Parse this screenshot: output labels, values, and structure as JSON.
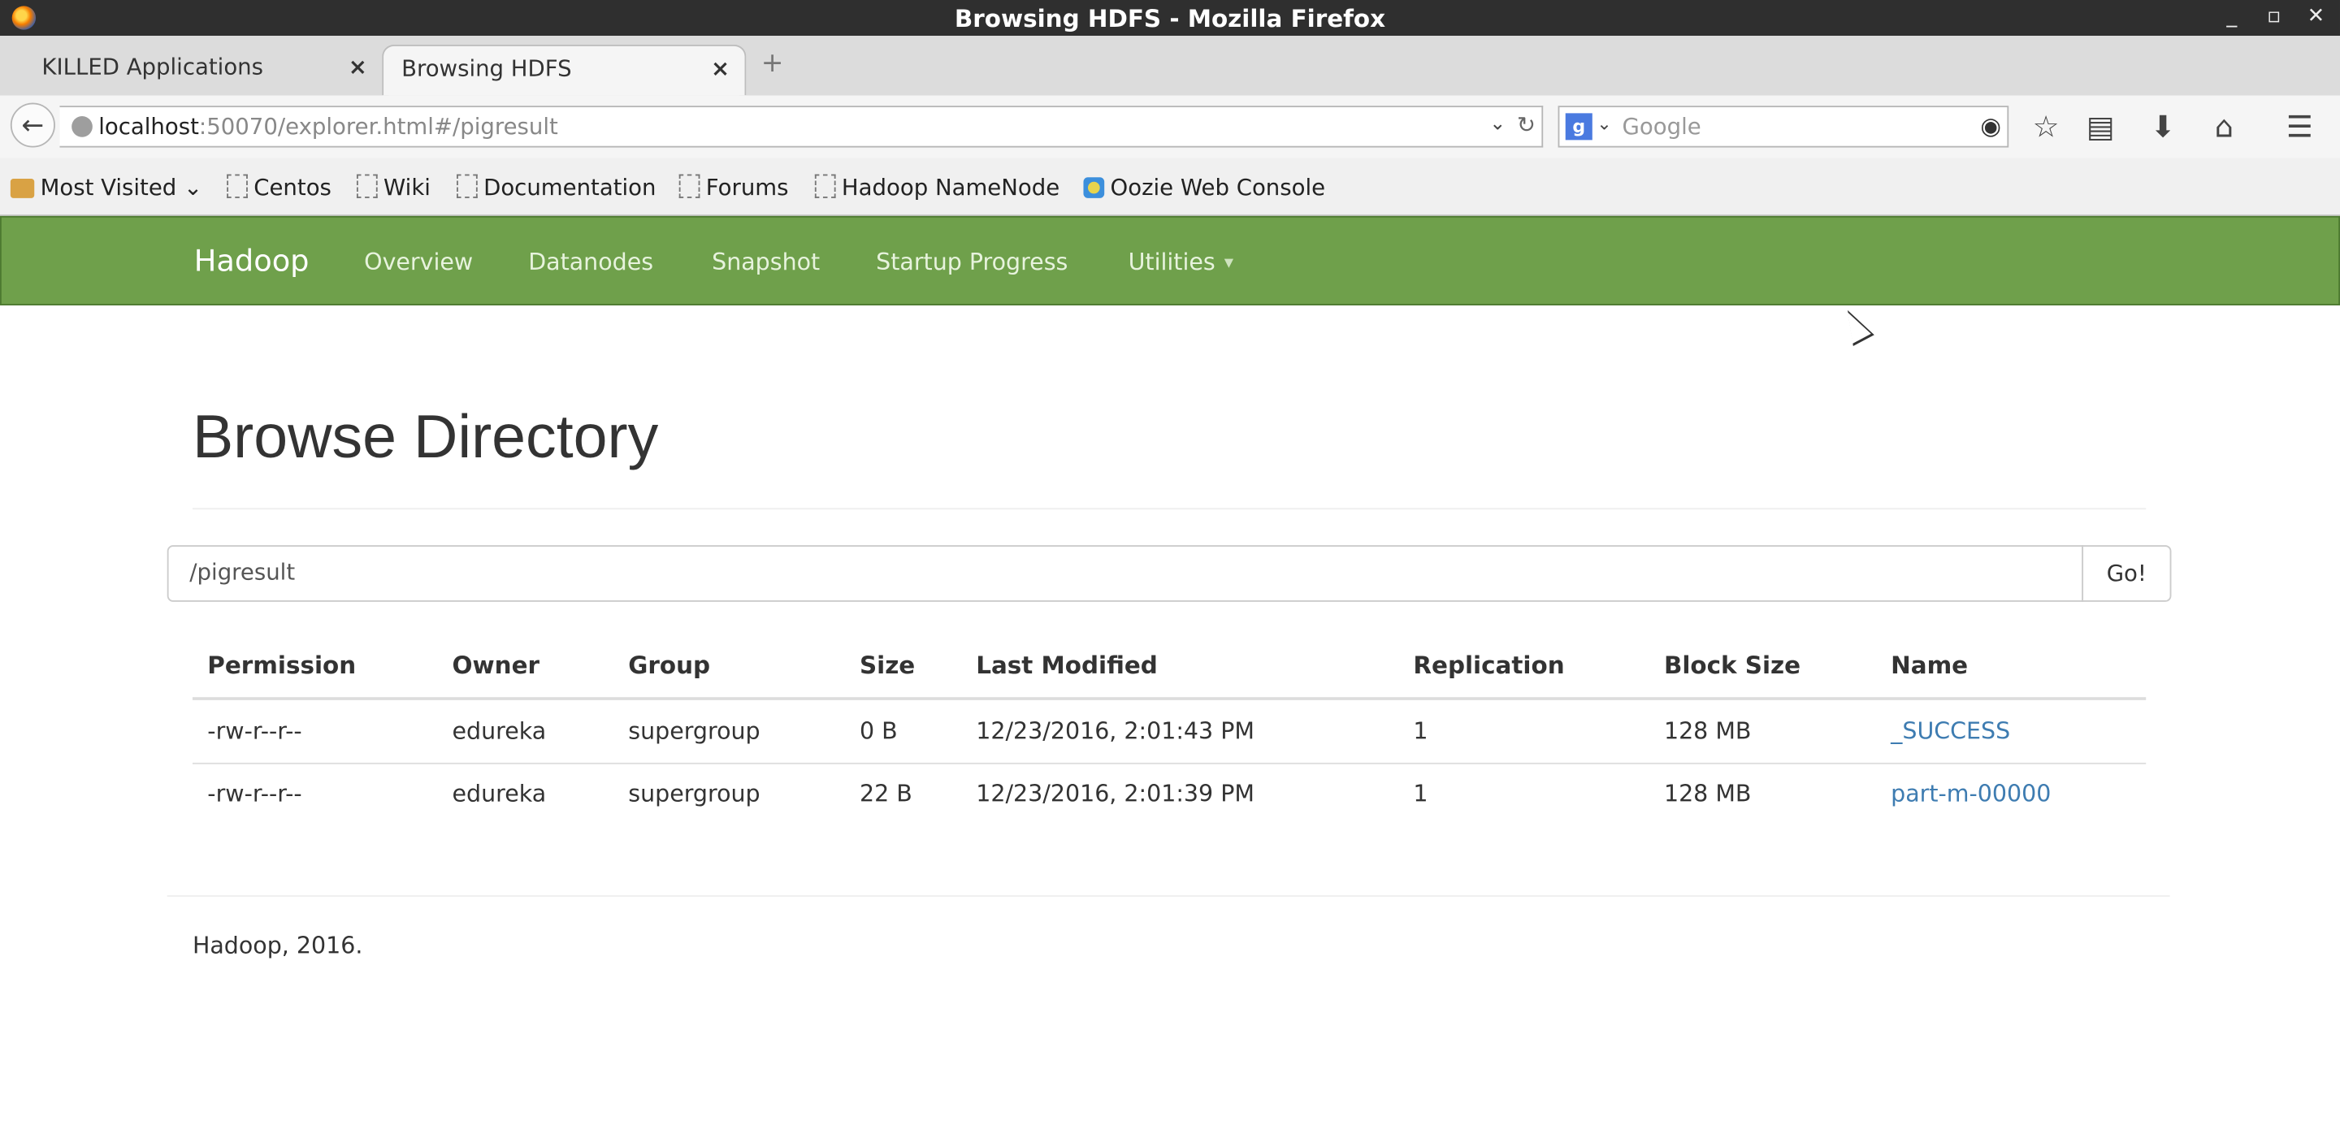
{
  "window": {
    "title": "Browsing HDFS - Mozilla Firefox",
    "minimize": "_",
    "maximize": "▫",
    "close": "✕"
  },
  "tabs": [
    {
      "label": "KILLED Applications",
      "close": "×"
    },
    {
      "label": "Browsing HDFS",
      "close": "×"
    }
  ],
  "new_tab": "+",
  "urlbar": {
    "host": "localhost",
    "rest": ":50070/explorer.html#/pigresult"
  },
  "search": {
    "engine": "g",
    "placeholder": "Google"
  },
  "bookmarks": [
    {
      "label": "Most Visited",
      "icon": "folder-icon"
    },
    {
      "label": "Centos",
      "icon": "bookmark-icon"
    },
    {
      "label": "Wiki",
      "icon": "bookmark-icon"
    },
    {
      "label": "Documentation",
      "icon": "bookmark-icon"
    },
    {
      "label": "Forums",
      "icon": "bookmark-icon"
    },
    {
      "label": "Hadoop NameNode",
      "icon": "bookmark-icon"
    },
    {
      "label": "Oozie Web Console",
      "icon": "oozie-icon"
    }
  ],
  "hadoop_nav": {
    "brand": "Hadoop",
    "items": [
      "Overview",
      "Datanodes",
      "Snapshot",
      "Startup Progress",
      "Utilities"
    ]
  },
  "page": {
    "heading": "Browse Directory",
    "path_value": "/pigresult",
    "go_label": "Go!",
    "footer": "Hadoop, 2016."
  },
  "table": {
    "headers": [
      "Permission",
      "Owner",
      "Group",
      "Size",
      "Last Modified",
      "Replication",
      "Block Size",
      "Name"
    ],
    "rows": [
      [
        "-rw-r--r--",
        "edureka",
        "supergroup",
        "0 B",
        "12/23/2016, 2:01:43 PM",
        "1",
        "128 MB",
        "_SUCCESS"
      ],
      [
        "-rw-r--r--",
        "edureka",
        "supergroup",
        "22 B",
        "12/23/2016, 2:01:39 PM",
        "1",
        "128 MB",
        "part-m-00000"
      ]
    ]
  },
  "colors": {
    "hadoop_green": "#6fa04b",
    "link": "#3e7cb1",
    "titlebar": "#2f2f2f"
  }
}
